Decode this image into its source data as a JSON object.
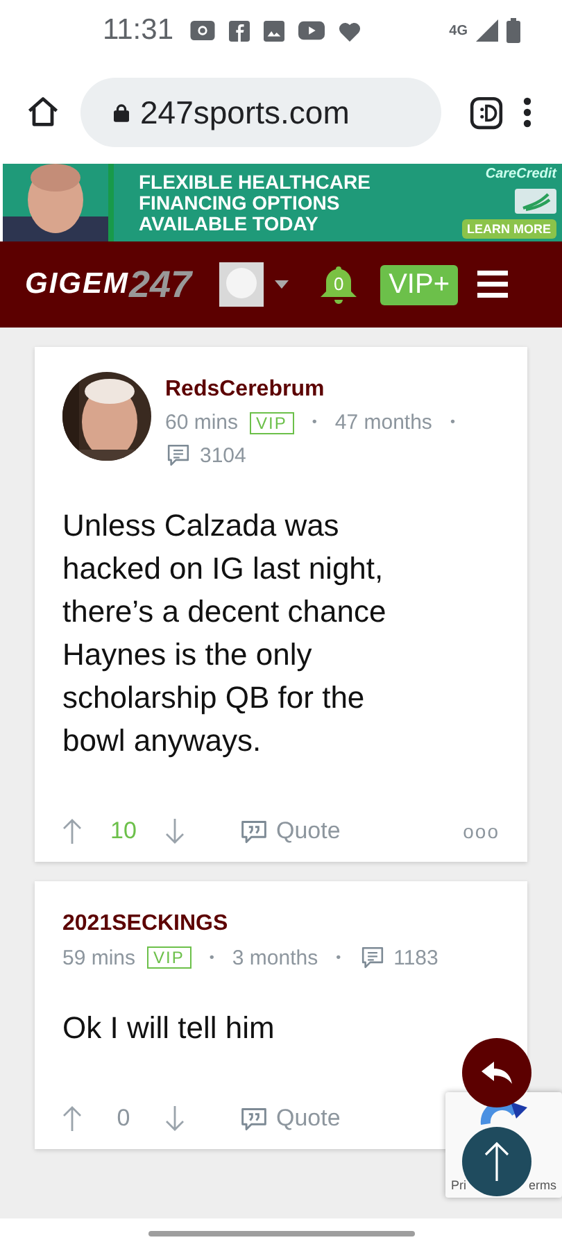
{
  "status_bar": {
    "time": "11:31",
    "network": "4G"
  },
  "browser": {
    "url": "247sports.com"
  },
  "ad": {
    "lines": [
      "FLEXIBLE HEALTHCARE",
      "FINANCING OPTIONS",
      "AVAILABLE TODAY"
    ],
    "brand": "CareCredit",
    "cta": "LEARN MORE"
  },
  "site_header": {
    "logo_word": "GIGEM",
    "logo_number": "247",
    "notifications": "0",
    "vip_button": "VIP+"
  },
  "posts": [
    {
      "author": "RedsCerebrum",
      "avatar": true,
      "time": "60 mins",
      "badge": "VIP",
      "tenure": "47 months",
      "separator": "•",
      "post_count": "3104",
      "meta_wrap": true,
      "text": "Unless Calzada was hacked on IG last night, there’s a decent chance Haynes is the only scholarship QB for the bowl anyways.",
      "score": "10",
      "score_positive": true,
      "quote_label": "Quote",
      "more": "ooo"
    },
    {
      "author": "2021SECKINGS",
      "avatar": false,
      "time": "59 mins",
      "badge": "VIP",
      "tenure": "3 months",
      "separator": "•",
      "post_count": "1183",
      "meta_wrap": false,
      "text": "Ok I will tell him",
      "score": "0",
      "score_positive": false,
      "quote_label": "Quote"
    }
  ],
  "recaptcha": {
    "left_text": "Pri",
    "right_text": "erms"
  }
}
